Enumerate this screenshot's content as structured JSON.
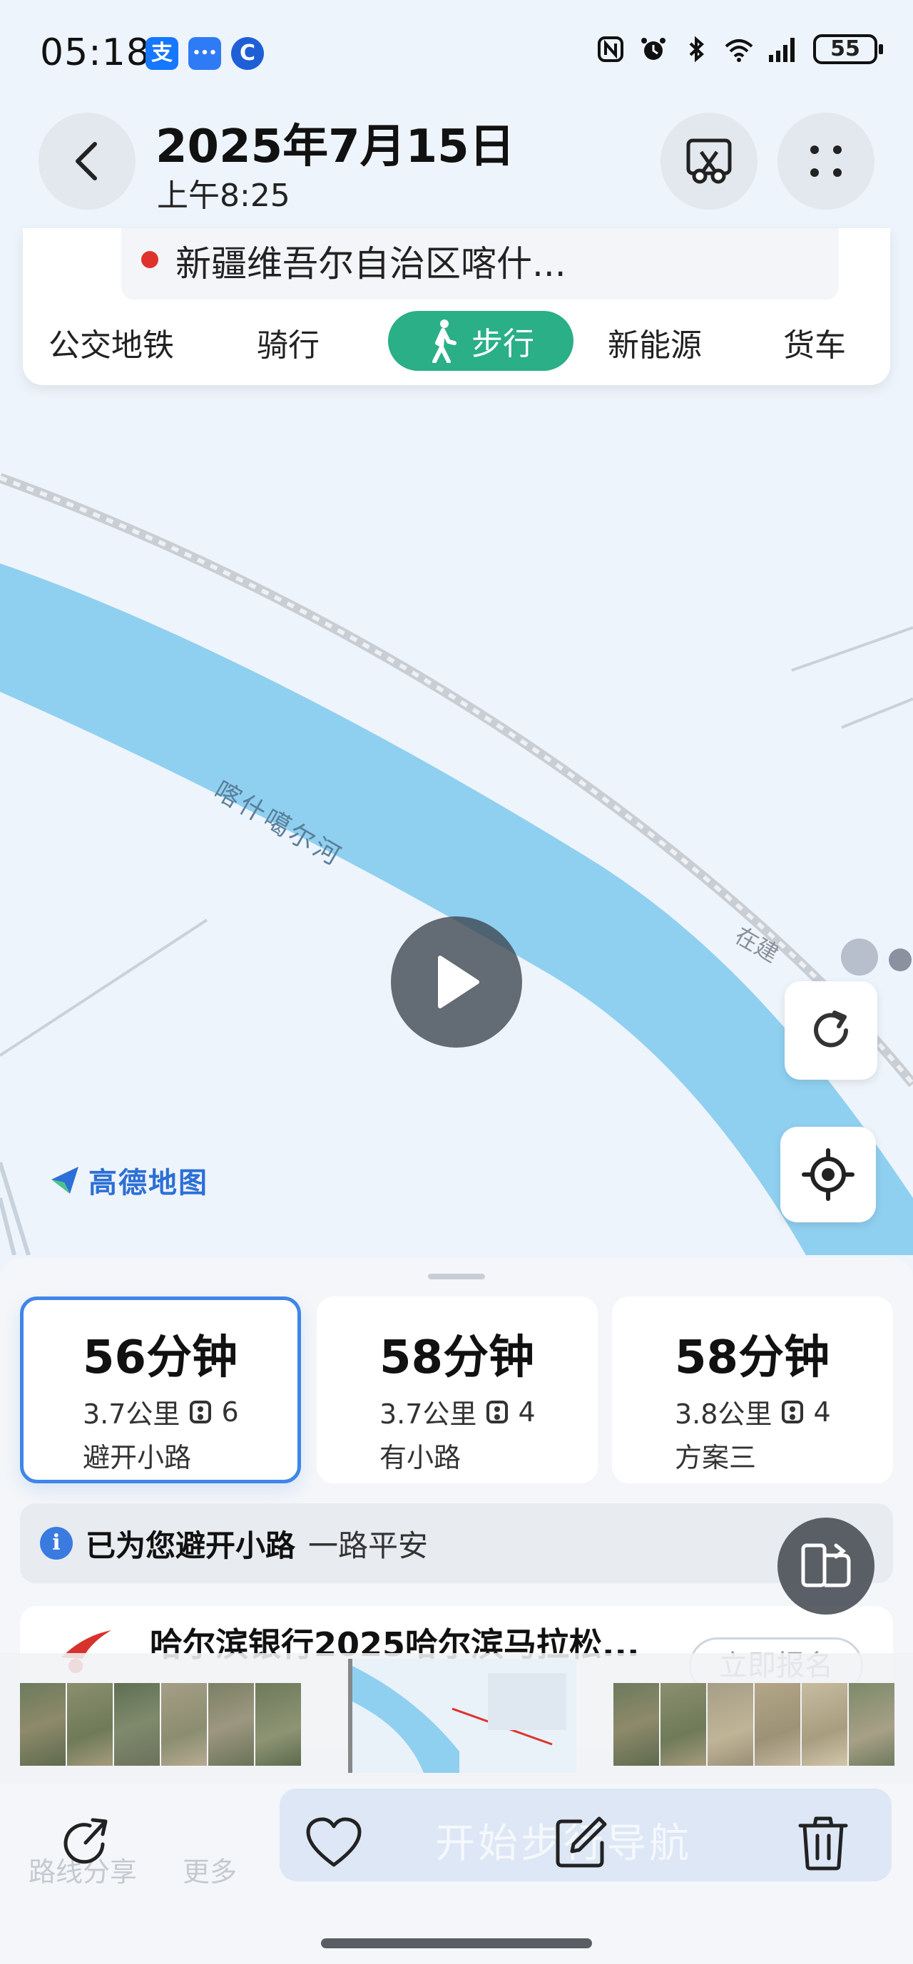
{
  "status_bar": {
    "time": "05:18",
    "apps": [
      {
        "name": "alipay-icon",
        "glyph": "支",
        "color": "#1677ff"
      },
      {
        "name": "message-icon",
        "glyph": "•••",
        "color": "#2f7bf5"
      },
      {
        "name": "app-c-icon",
        "glyph": "C",
        "color": "#1e5fd6"
      }
    ],
    "battery": "55"
  },
  "photo_header": {
    "date": "2025年7月15日",
    "time": "上午8:25"
  },
  "route_panel": {
    "destination": "新疆维吾尔自治区喀什...",
    "modes": [
      "公交地铁",
      "骑行",
      "步行",
      "新能源",
      "货车"
    ],
    "active_mode": "步行"
  },
  "map": {
    "river_label": "喀什噶尔河",
    "construction_label": "在建",
    "logo_text": "高德地图",
    "river_color": "#8fd0f0",
    "accent": "#2aaf87"
  },
  "routes": [
    {
      "time": "56分钟",
      "distance": "3.7公里",
      "lights": "6",
      "label": "避开小路",
      "selected": true
    },
    {
      "time": "58分钟",
      "distance": "3.7公里",
      "lights": "4",
      "label": "有小路",
      "selected": false
    },
    {
      "time": "58分钟",
      "distance": "3.8公里",
      "lights": "4",
      "label": "方案三",
      "selected": false
    }
  ],
  "notice": {
    "icon": "i",
    "main": "已为您避开小路",
    "sub": "一路平安"
  },
  "promo": {
    "title": "哈尔滨银行2025哈尔滨马拉松...",
    "button": "立即报名"
  },
  "bottom_bar": {
    "faint_nav": "开始步行导航",
    "faint_share": "路线分享",
    "faint_more": "更多",
    "actions": [
      "share-icon",
      "heart-icon",
      "edit-icon",
      "trash-icon"
    ]
  }
}
